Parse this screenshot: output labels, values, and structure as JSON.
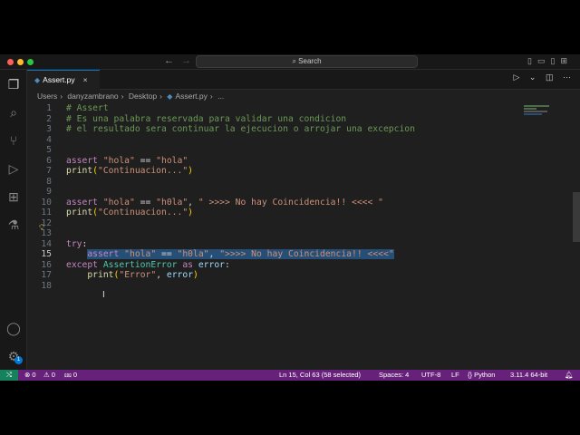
{
  "titlebar": {
    "back": "←",
    "forward": "→",
    "search_label": "Search",
    "search_icon": "search-icon"
  },
  "tab": {
    "label": "Assert.py",
    "close": "×"
  },
  "breadcrumb": [
    "Users",
    "danyzambrano",
    "Desktop",
    "Assert.py",
    "..."
  ],
  "editor_actions": {
    "run": "▷",
    "run_menu": "⌄",
    "split": "◫",
    "more": "···"
  },
  "editor": {
    "current_line": 15,
    "selected_line": 15,
    "lines": [
      [
        [
          "com",
          "# Assert"
        ]
      ],
      [
        [
          "com",
          "# Es una palabra reservada para validar una condicion"
        ]
      ],
      [
        [
          "com",
          "# el resultado sera continuar la ejecucion o arrojar una excepcion"
        ]
      ],
      [],
      [],
      [
        [
          "kw",
          "assert "
        ],
        [
          "str",
          "\"hola\""
        ],
        [
          "p",
          " == "
        ],
        [
          "str",
          "\"hola\""
        ]
      ],
      [
        [
          "fn",
          "print"
        ],
        [
          "br",
          "("
        ],
        [
          "str",
          "\"Continuacion...\""
        ],
        [
          "br",
          ")"
        ]
      ],
      [],
      [],
      [
        [
          "kw",
          "assert "
        ],
        [
          "str",
          "\"hola\""
        ],
        [
          "p",
          " == "
        ],
        [
          "str",
          "\"h0la\""
        ],
        [
          "p",
          ", "
        ],
        [
          "str",
          "\" >>>> No hay Coincidencia!! <<<< \""
        ]
      ],
      [
        [
          "fn",
          "print"
        ],
        [
          "br",
          "("
        ],
        [
          "str",
          "\"Continuacion...\""
        ],
        [
          "br",
          ")"
        ]
      ],
      [],
      [],
      [
        [
          "kw",
          "try"
        ],
        [
          "p",
          ":"
        ]
      ],
      [
        [
          "p",
          "    "
        ],
        [
          "kw",
          "assert "
        ],
        [
          "str",
          "\"hola\""
        ],
        [
          "p",
          " == "
        ],
        [
          "str",
          "\"h0la\""
        ],
        [
          "p",
          ", "
        ],
        [
          "str",
          "\">>>> No hay Coincidencia!! <<<<\""
        ]
      ],
      [
        [
          "kw",
          "except "
        ],
        [
          "cls",
          "AssertionError"
        ],
        [
          "kw",
          " as "
        ],
        [
          "var",
          "error"
        ],
        [
          "p",
          ":"
        ]
      ],
      [
        [
          "p",
          "    "
        ],
        [
          "fn",
          "print"
        ],
        [
          "br",
          "("
        ],
        [
          "str",
          "\"Error\""
        ],
        [
          "p",
          ", "
        ],
        [
          "var",
          "error"
        ],
        [
          "br",
          ")"
        ]
      ],
      []
    ]
  },
  "status": {
    "errors": "⊗ 0",
    "warnings": "⚠ 0",
    "ports": "⅏ 0",
    "position": "Ln 15, Col 63 (58 selected)",
    "spaces": "Spaces: 4",
    "encoding": "UTF-8",
    "eol": "LF",
    "language": "{} Python",
    "interpreter": "3.11.4 64-bit",
    "notifications": "🔔︎"
  },
  "accounts_badge": "1"
}
